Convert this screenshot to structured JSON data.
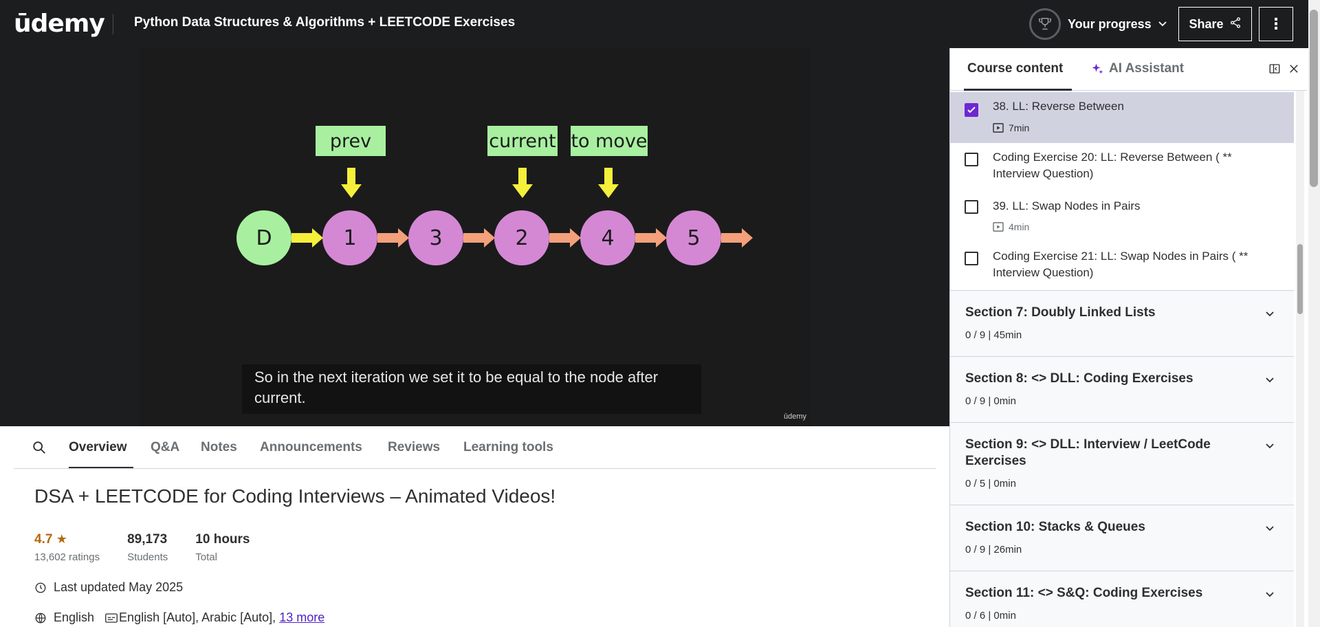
{
  "header": {
    "logo_text": "ūdemy",
    "course_title": "Python Data Structures & Algorithms + LEETCODE Exercises",
    "progress_label": "Your progress",
    "share_label": "Share",
    "more_label": "⋮"
  },
  "video": {
    "labels": [
      "prev",
      "current",
      "to move"
    ],
    "nodes": [
      "D",
      "1",
      "3",
      "2",
      "4",
      "5"
    ],
    "caption": "So in the next iteration we set it to be equal to the node after current.",
    "watermark": "ūdemy"
  },
  "tabs": [
    "Overview",
    "Q&A",
    "Notes",
    "Announcements",
    "Reviews",
    "Learning tools"
  ],
  "overview": {
    "title": "DSA + LEETCODE for Coding Interviews – Animated Videos!",
    "rating": "4.7",
    "ratings_count": "13,602 ratings",
    "students": "89,173",
    "students_label": "Students",
    "hours": "10 hours",
    "hours_label": "Total",
    "last_updated": "Last updated May 2025",
    "language": "English",
    "captions": "English [Auto], Arabic [Auto], ",
    "more_link": "13 more"
  },
  "sidebar": {
    "tab_content": "Course content",
    "tab_ai": "AI Assistant",
    "lectures": [
      {
        "title": "38. LL: Reverse Between",
        "duration": "7min",
        "checked": true
      },
      {
        "title": "Coding Exercise 20: LL: Reverse Between ( ** Interview Question)",
        "duration": "",
        "checked": false
      },
      {
        "title": "39. LL: Swap Nodes in Pairs",
        "duration": "4min",
        "checked": false
      },
      {
        "title": "Coding Exercise 21: LL: Swap Nodes in Pairs ( ** Interview Question)",
        "duration": "",
        "checked": false
      }
    ],
    "sections": [
      {
        "title": "Section 7: Doubly Linked Lists",
        "meta": "0 / 9 | 45min"
      },
      {
        "title": "Section 8: <> DLL: Coding Exercises",
        "meta": "0 / 9 | 0min"
      },
      {
        "title": "Section 9: <> DLL: Interview / LeetCode Exercises",
        "meta": "0 / 5 | 0min"
      },
      {
        "title": "Section 10: Stacks & Queues",
        "meta": "0 / 9 | 26min"
      },
      {
        "title": "Section 11: <> S&Q: Coding Exercises",
        "meta": "0 / 6 | 0min"
      }
    ]
  },
  "colors": {
    "accent_purple": "#6d28d2",
    "header_bg": "#1c1d1f",
    "rating_orange": "#b4690e",
    "node_green": "#a8f0a0",
    "node_pink": "#d488d4",
    "arrow_yellow": "#f5f03a",
    "arrow_salmon": "#f4a07a"
  }
}
